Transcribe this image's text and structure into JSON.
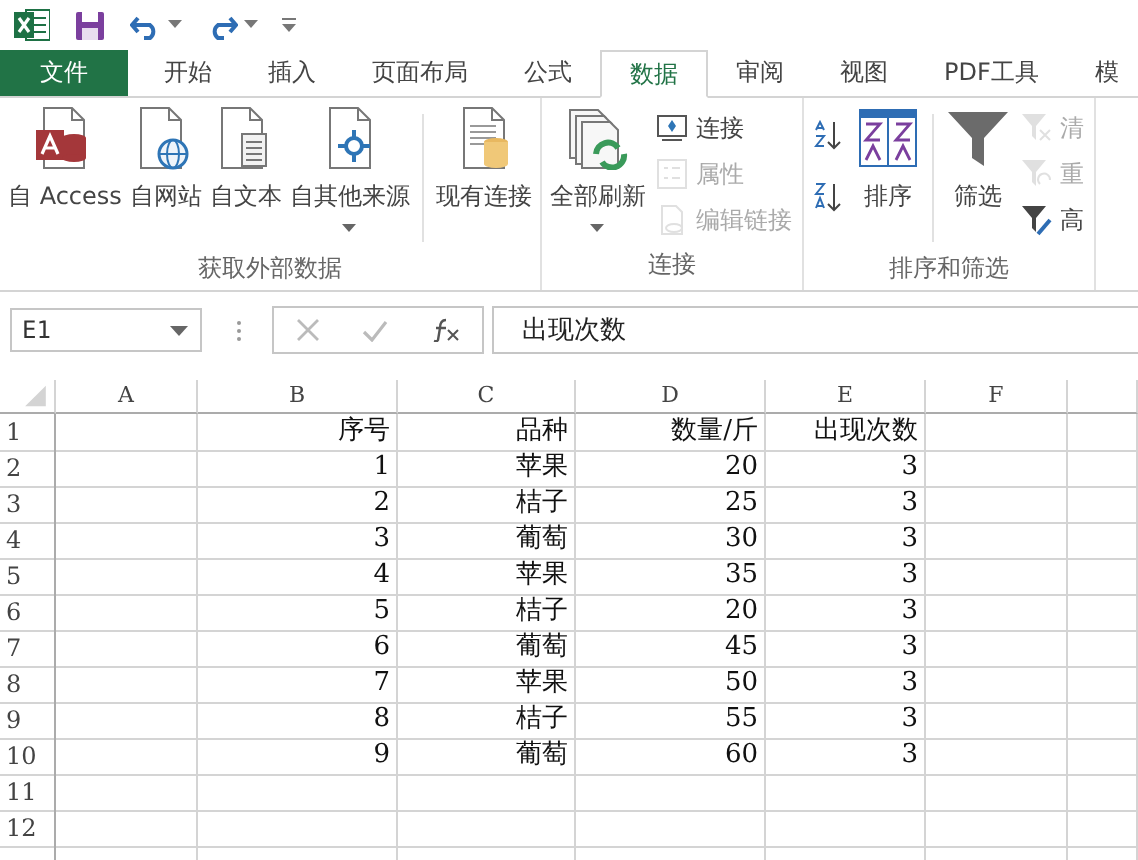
{
  "tabs": [
    {
      "label": "文件",
      "kind": "file",
      "selected": false
    },
    {
      "label": "开始",
      "kind": "tab",
      "selected": false
    },
    {
      "label": "插入",
      "kind": "tab",
      "selected": false
    },
    {
      "label": "页面布局",
      "kind": "tab",
      "selected": false
    },
    {
      "label": "公式",
      "kind": "tab",
      "selected": false
    },
    {
      "label": "数据",
      "kind": "tab",
      "selected": true
    },
    {
      "label": "审阅",
      "kind": "tab",
      "selected": false
    },
    {
      "label": "视图",
      "kind": "tab",
      "selected": false
    },
    {
      "label": "PDF工具",
      "kind": "tab",
      "selected": false
    },
    {
      "label": "模",
      "kind": "tab",
      "selected": false
    }
  ],
  "ribbon_groups": [
    {
      "label": "获取外部数据",
      "columns": [
        [
          {
            "label": "自 Access",
            "kind": "large",
            "dropdown": false,
            "disabled": false
          }
        ],
        [
          {
            "label": "自网站",
            "kind": "large",
            "dropdown": false,
            "disabled": false
          }
        ],
        [
          {
            "label": "自文本",
            "kind": "large",
            "dropdown": false,
            "disabled": false
          }
        ],
        [
          {
            "label": "自其他来源",
            "kind": "large",
            "dropdown": true,
            "disabled": false
          }
        ],
        [
          {
            "kind": "separator"
          }
        ],
        [
          {
            "label": "现有连接",
            "kind": "large",
            "dropdown": false,
            "disabled": false
          }
        ]
      ]
    },
    {
      "label": "连接",
      "columns": [
        [
          {
            "label": "全部刷新",
            "kind": "large",
            "dropdown": true,
            "disabled": false
          }
        ],
        [
          {
            "label": "连接",
            "kind": "small",
            "disabled": false
          },
          {
            "label": "属性",
            "kind": "small",
            "disabled": true
          },
          {
            "label": "编辑链接",
            "kind": "small",
            "disabled": true
          }
        ]
      ]
    },
    {
      "label": "排序和筛选",
      "columns": [
        [
          {
            "kind": "icon",
            "disabled": false
          },
          {
            "kind": "icon",
            "disabled": false
          }
        ],
        [
          {
            "label": "排序",
            "kind": "large",
            "dropdown": false,
            "disabled": false
          }
        ],
        [
          {
            "kind": "separator"
          }
        ],
        [
          {
            "label": "筛选",
            "kind": "large",
            "dropdown": false,
            "disabled": false
          }
        ],
        [
          {
            "label": "清",
            "kind": "small",
            "disabled": true
          },
          {
            "label": "重",
            "kind": "small",
            "disabled": true
          },
          {
            "label": "高",
            "kind": "small",
            "disabled": false
          }
        ]
      ]
    }
  ],
  "name_box": {
    "value": "E1"
  },
  "formula_bar": {
    "value": "出现次数"
  },
  "sheet": {
    "columns": [
      "A",
      "B",
      "C",
      "D",
      "E",
      "F"
    ],
    "rows": [
      {
        "header": "1",
        "cells": {
          "B": "序号",
          "C": "品种",
          "D": "数量/斤",
          "E": "出现次数"
        }
      },
      {
        "header": "2",
        "cells": {
          "B": "1",
          "C": "苹果",
          "D": "20",
          "E": "3"
        }
      },
      {
        "header": "3",
        "cells": {
          "B": "2",
          "C": "桔子",
          "D": "25",
          "E": "3"
        }
      },
      {
        "header": "4",
        "cells": {
          "B": "3",
          "C": "葡萄",
          "D": "30",
          "E": "3"
        }
      },
      {
        "header": "5",
        "cells": {
          "B": "4",
          "C": "苹果",
          "D": "35",
          "E": "3"
        }
      },
      {
        "header": "6",
        "cells": {
          "B": "5",
          "C": "桔子",
          "D": "20",
          "E": "3"
        }
      },
      {
        "header": "7",
        "cells": {
          "B": "6",
          "C": "葡萄",
          "D": "45",
          "E": "3"
        }
      },
      {
        "header": "8",
        "cells": {
          "B": "7",
          "C": "苹果",
          "D": "50",
          "E": "3"
        }
      },
      {
        "header": "9",
        "cells": {
          "B": "8",
          "C": "桔子",
          "D": "55",
          "E": "3"
        }
      },
      {
        "header": "10",
        "cells": {
          "B": "9",
          "C": "葡萄",
          "D": "60",
          "E": "3"
        }
      },
      {
        "header": "11",
        "cells": {}
      },
      {
        "header": "12",
        "cells": {}
      }
    ]
  }
}
